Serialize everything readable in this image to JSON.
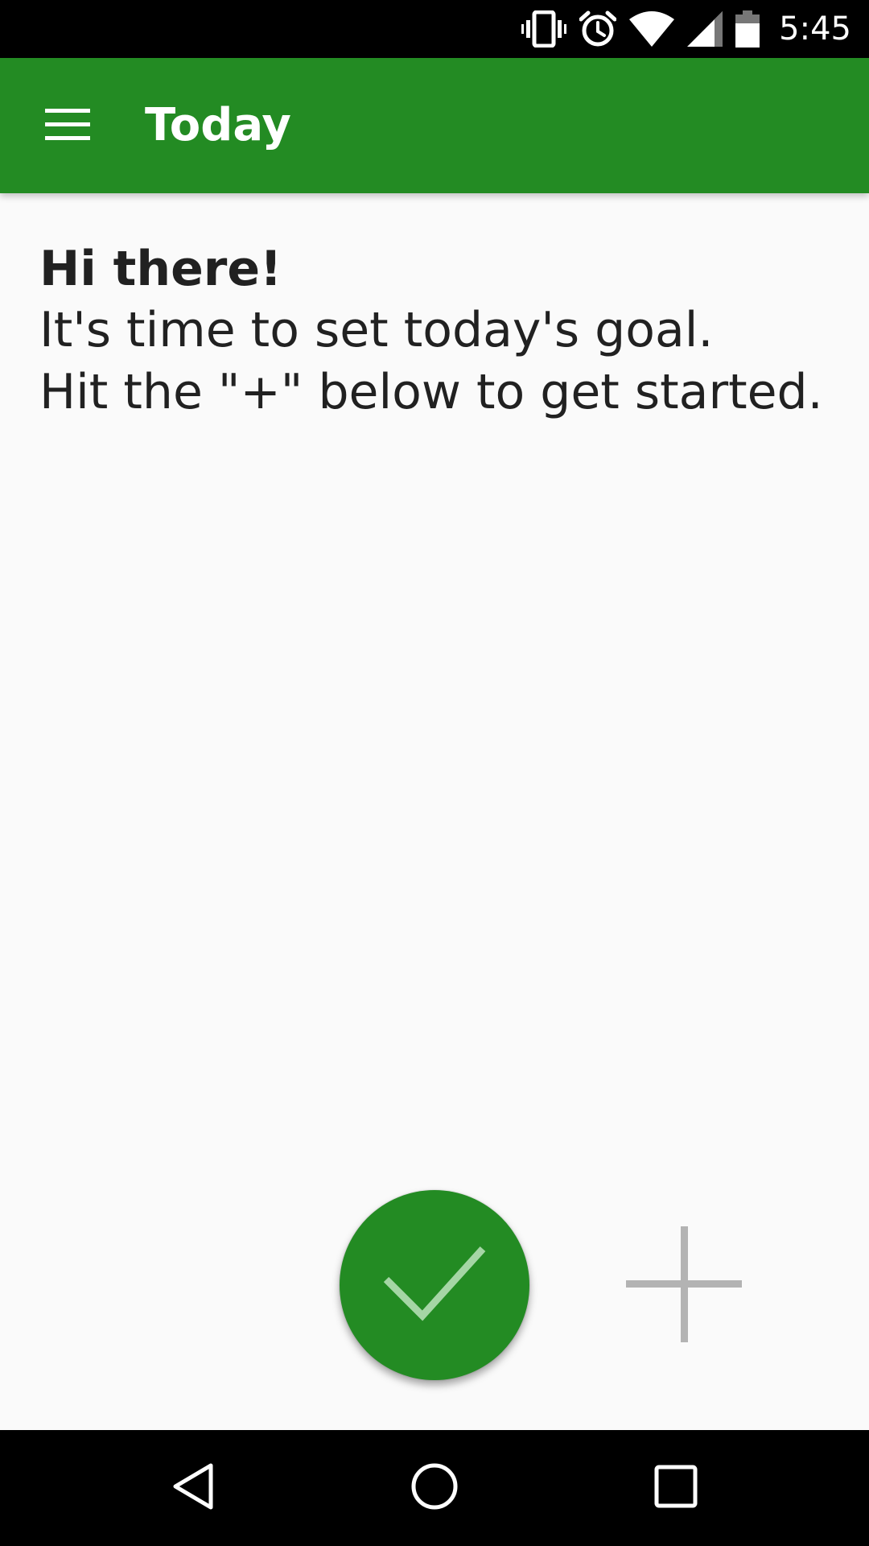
{
  "status_bar": {
    "time": "5:45",
    "icons": [
      "vibrate-icon",
      "alarm-icon",
      "wifi-icon",
      "signal-icon",
      "battery-icon"
    ]
  },
  "app_bar": {
    "title": "Today",
    "menu_icon": "menu-icon",
    "color": "#238b23"
  },
  "content": {
    "greeting": "Hi there!",
    "line1": "It's time to set today's goal.",
    "line2": "Hit the \"+\" below to get started."
  },
  "actions": {
    "done_icon": "check-icon",
    "add_icon": "plus-icon",
    "fab_color": "#238b23"
  },
  "nav_bar": {
    "icons": [
      "back-icon",
      "home-icon",
      "recents-icon"
    ]
  }
}
